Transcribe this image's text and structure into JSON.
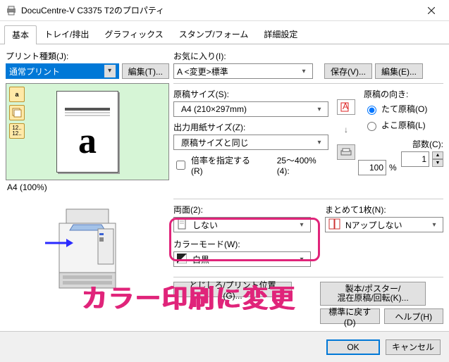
{
  "window": {
    "title": "DocuCentre-V C3375 T2のプロパティ"
  },
  "tabs": [
    "基本",
    "トレイ/排出",
    "グラフィックス",
    "スタンプ/フォーム",
    "詳細設定"
  ],
  "left": {
    "print_type_label": "プリント種類(J):",
    "print_type_value": "通常プリント",
    "edit_button": "編集(T)...",
    "preview_char": "a",
    "size_text": "A4 (100%)"
  },
  "right": {
    "favorite_label": "お気に入り(I):",
    "favorite_value": "A <変更>標準",
    "save_button": "保存(V)...",
    "edit_button": "編集(E)...",
    "orig_size_label": "原稿サイズ(S):",
    "orig_size_value": "A4 (210×297mm)",
    "out_size_label": "出力用紙サイズ(Z):",
    "out_size_value": "原稿サイズと同じ",
    "orient_label": "原稿の向き:",
    "orient_portrait": "たて原稿(O)",
    "orient_landscape": "よこ原稿(L)",
    "ratio_check": "倍率を指定する(R)",
    "ratio_range": "25～400%(4):",
    "ratio_val": "100",
    "ratio_unit": "%",
    "copies_label": "部数(C):",
    "copies_val": "1",
    "duplex_label": "両面(2):",
    "duplex_value": "しない",
    "nup_label": "まとめて1枚(N):",
    "nup_value": "Nアップしない",
    "color_label": "カラーモード(W):",
    "color_value": "白黒",
    "binding_btn": "とじしろ/プリント位置(G)...",
    "booklet_btn": "製本/ポスター/\n混在原稿/回転(K)...",
    "defaults_btn": "標準に戻す(D)",
    "help_btn": "ヘルプ(H)"
  },
  "footer": {
    "ok": "OK",
    "cancel": "キャンセル"
  },
  "annotation": {
    "text": "カラー印刷に変更"
  }
}
